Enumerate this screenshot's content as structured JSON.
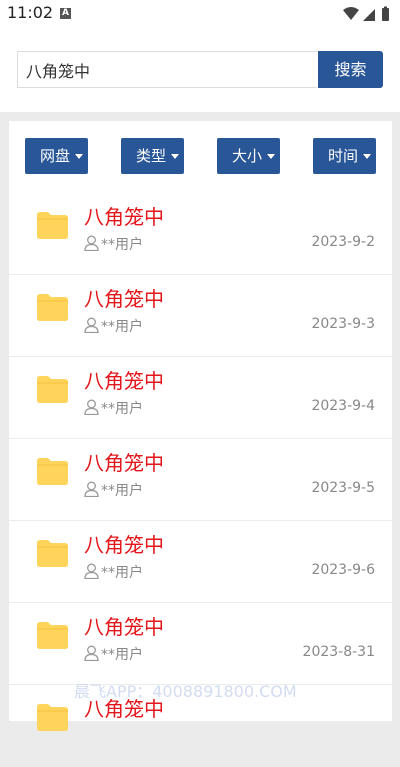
{
  "status": {
    "time": "11:02",
    "notification": "A"
  },
  "search": {
    "value": "八角笼中",
    "button": "搜索"
  },
  "filters": [
    {
      "label": "网盘"
    },
    {
      "label": "类型"
    },
    {
      "label": "大小"
    },
    {
      "label": "时间"
    }
  ],
  "results": [
    {
      "title": "八角笼中",
      "user": "**用户",
      "date": "2023-9-2"
    },
    {
      "title": "八角笼中",
      "user": "**用户",
      "date": "2023-9-3"
    },
    {
      "title": "八角笼中",
      "user": "**用户",
      "date": "2023-9-4"
    },
    {
      "title": "八角笼中",
      "user": "**用户",
      "date": "2023-9-5"
    },
    {
      "title": "八角笼中",
      "user": "**用户",
      "date": "2023-9-6"
    },
    {
      "title": "八角笼中",
      "user": "**用户",
      "date": "2023-8-31"
    },
    {
      "title": "八角笼中",
      "user": "",
      "date": ""
    }
  ],
  "watermark": "晨飞APP：4008891800.COM",
  "colors": {
    "accent": "#285696",
    "title": "#e3171b",
    "folder": "#ffd45a"
  }
}
